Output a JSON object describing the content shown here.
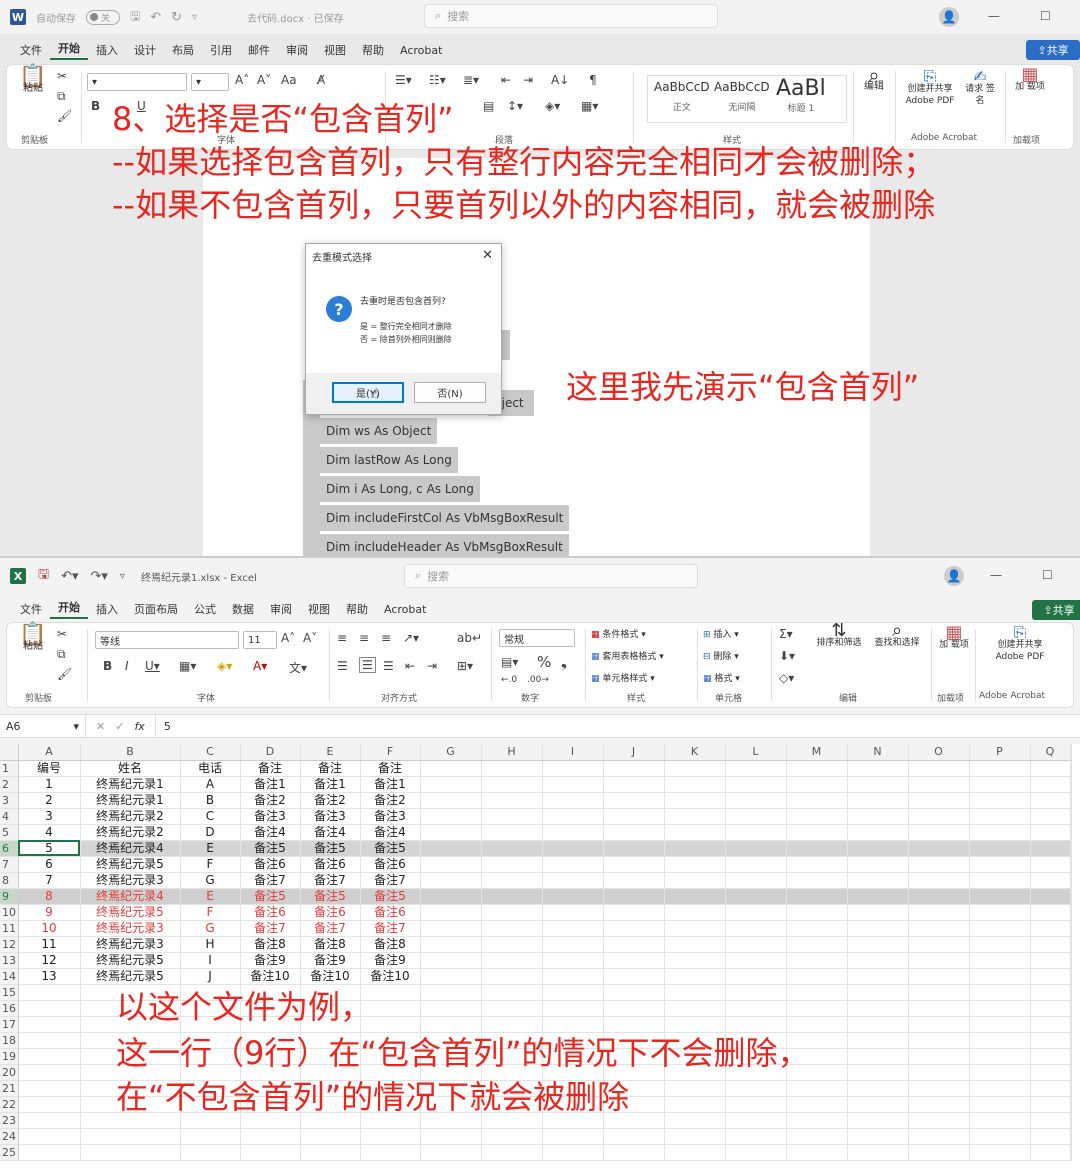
{
  "word": {
    "autosave_label": "自动保存",
    "autosave_state": "关",
    "doc_title": "去代码.docx · 已保存",
    "search_placeholder": "搜索",
    "tabs": [
      "文件",
      "开始",
      "插入",
      "设计",
      "布局",
      "引用",
      "邮件",
      "审阅",
      "视图",
      "帮助",
      "Acrobat"
    ],
    "active_tab": "开始",
    "share_label": "共享",
    "ribbon": {
      "clipboard": {
        "paste": "粘贴",
        "group": "剪贴板"
      },
      "font_group": "字体",
      "paragraph_group": "段落",
      "styles_group": "样式",
      "styles": [
        {
          "preview": "AaBbCcD",
          "name": "正文"
        },
        {
          "preview": "AaBbCcD",
          "name": "无间隔"
        },
        {
          "preview": "AaBl",
          "name": "标题 1"
        }
      ],
      "edit": "编辑",
      "create_pdf": "创建并共享 Adobe PDF",
      "request_sign": "请求 签名",
      "acrobat_group": "Adobe Acrobat",
      "addins": "加 载项",
      "addins_group": "加载项"
    },
    "code_lines": [
      "Dim ws As Object",
      "Dim lastRow As Long",
      "Dim i As Long, c As Long",
      "Dim includeFirstCol As VbMsgBoxResult",
      "Dim includeHeader As VbMsgBoxResult"
    ],
    "partial_code": "bject"
  },
  "dialog": {
    "title": "去重模式选择",
    "question": "去重时是否包含首列?",
    "line1": "是 = 整行完全相同才删除",
    "line2": "否 = 除首列外相同则删除",
    "yes": "是(Y)",
    "no": "否(N)"
  },
  "notes": {
    "step": "8、选择是否“包含首列”",
    "line2": "--如果选择包含首列，只有整行内容完全相同才会被删除；",
    "line3": "--如果不包含首列，只要首列以外的内容相同，就会被删除",
    "demo": "这里我先演示“包含首列”",
    "ex1": "以这个文件为例，",
    "ex2": "这一行（9行）在“包含首列”的情况下不会删除，",
    "ex3": "在“不包含首列”的情况下就会被删除"
  },
  "excel": {
    "file_title": "终焉纪元录1.xlsx - Excel",
    "search_placeholder": "搜索",
    "tabs": [
      "文件",
      "开始",
      "插入",
      "页面布局",
      "公式",
      "数据",
      "审阅",
      "视图",
      "帮助",
      "Acrobat"
    ],
    "active_tab": "开始",
    "share_label": "共享",
    "ribbon": {
      "paste": "粘贴",
      "clipboard_group": "剪贴板",
      "font_name": "等线",
      "font_size": "11",
      "font_group": "字体",
      "align_group": "对齐方式",
      "number_format": "常规",
      "number_group": "数字",
      "cond_format": "条件格式",
      "table_format": "套用表格格式",
      "cell_style": "单元格样式",
      "styles_group": "样式",
      "insert": "插入",
      "delete": "删除",
      "format": "格式",
      "cells_group": "单元格",
      "sort_filter": "排序和筛选",
      "find_select": "查找和选择",
      "edit_group": "编辑",
      "addins": "加 载项",
      "addins_group": "加载项",
      "create_pdf": "创建并共享 Adobe PDF",
      "acrobat_group": "Adobe Acrobat"
    },
    "name_box": "A6",
    "formula_value": "5",
    "columns": [
      "A",
      "B",
      "C",
      "D",
      "E",
      "F",
      "G",
      "H",
      "I",
      "J",
      "K",
      "L",
      "M",
      "N",
      "O",
      "P",
      "Q"
    ],
    "rows": [
      [
        "编号",
        "姓名",
        "电话",
        "备注",
        "备注",
        "备注"
      ],
      [
        "1",
        "终焉纪元录1",
        "A",
        "备注1",
        "备注1",
        "备注1"
      ],
      [
        "2",
        "终焉纪元录1",
        "B",
        "备注2",
        "备注2",
        "备注2"
      ],
      [
        "3",
        "终焉纪元录2",
        "C",
        "备注3",
        "备注3",
        "备注3"
      ],
      [
        "4",
        "终焉纪元录2",
        "D",
        "备注4",
        "备注4",
        "备注4"
      ],
      [
        "5",
        "终焉纪元录4",
        "E",
        "备注5",
        "备注5",
        "备注5"
      ],
      [
        "6",
        "终焉纪元录5",
        "F",
        "备注6",
        "备注6",
        "备注6"
      ],
      [
        "7",
        "终焉纪元录3",
        "G",
        "备注7",
        "备注7",
        "备注7"
      ],
      [
        "8",
        "终焉纪元录4",
        "E",
        "备注5",
        "备注5",
        "备注5"
      ],
      [
        "9",
        "终焉纪元录5",
        "F",
        "备注6",
        "备注6",
        "备注6"
      ],
      [
        "10",
        "终焉纪元录3",
        "G",
        "备注7",
        "备注7",
        "备注7"
      ],
      [
        "11",
        "终焉纪元录3",
        "H",
        "备注8",
        "备注8",
        "备注8"
      ],
      [
        "12",
        "终焉纪元录5",
        "I",
        "备注9",
        "备注9",
        "备注9"
      ],
      [
        "13",
        "终焉纪元录5",
        "J",
        "备注10",
        "备注10",
        "备注10"
      ]
    ],
    "row_numbers": [
      "1",
      "2",
      "3",
      "4",
      "5",
      "6",
      "7",
      "8",
      "9",
      "10",
      "11",
      "12",
      "13",
      "14",
      "15",
      "16",
      "17",
      "18",
      "19",
      "20",
      "21",
      "22",
      "23",
      "24",
      "25"
    ],
    "colors": {
      "accent": "#217346",
      "red_text": "#e23b3b",
      "note_red": "#e8261e"
    }
  }
}
